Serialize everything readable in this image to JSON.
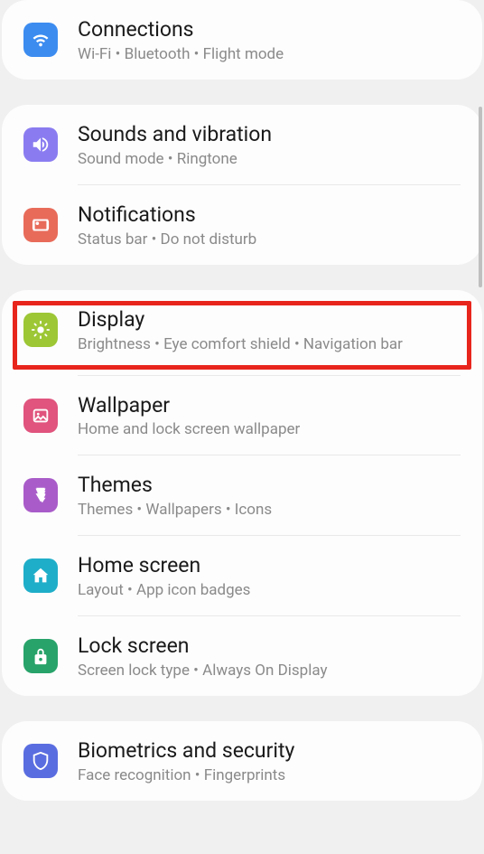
{
  "groups": [
    {
      "items": [
        {
          "key": "connections",
          "title": "Connections",
          "subtitle": "Wi-Fi  •  Bluetooth  •  Flight mode",
          "icon": "wifi",
          "color": "#3c8cf0"
        }
      ]
    },
    {
      "items": [
        {
          "key": "sounds",
          "title": "Sounds and vibration",
          "subtitle": "Sound mode  •  Ringtone",
          "icon": "speaker",
          "color": "#8a7cf0"
        },
        {
          "key": "notifications",
          "title": "Notifications",
          "subtitle": "Status bar  •  Do not disturb",
          "icon": "notification",
          "color": "#e86b5a"
        }
      ]
    },
    {
      "items": [
        {
          "key": "display",
          "title": "Display",
          "subtitle": "Brightness  •  Eye comfort shield  •  Navigation bar",
          "icon": "brightness",
          "color": "#9dc735",
          "highlighted": true
        },
        {
          "key": "wallpaper",
          "title": "Wallpaper",
          "subtitle": "Home and lock screen wallpaper",
          "icon": "image",
          "color": "#e0547d"
        },
        {
          "key": "themes",
          "title": "Themes",
          "subtitle": "Themes  •  Wallpapers  •  Icons",
          "icon": "themes",
          "color": "#a95cc9"
        },
        {
          "key": "homescreen",
          "title": "Home screen",
          "subtitle": "Layout  •  App icon badges",
          "icon": "home",
          "color": "#1faec9"
        },
        {
          "key": "lockscreen",
          "title": "Lock screen",
          "subtitle": "Screen lock type  •  Always On Display",
          "icon": "lock",
          "color": "#28a36a"
        }
      ]
    },
    {
      "items": [
        {
          "key": "biometrics",
          "title": "Biometrics and security",
          "subtitle": "Face recognition  •  Fingerprints",
          "icon": "shield",
          "color": "#5a6de0"
        }
      ]
    }
  ]
}
